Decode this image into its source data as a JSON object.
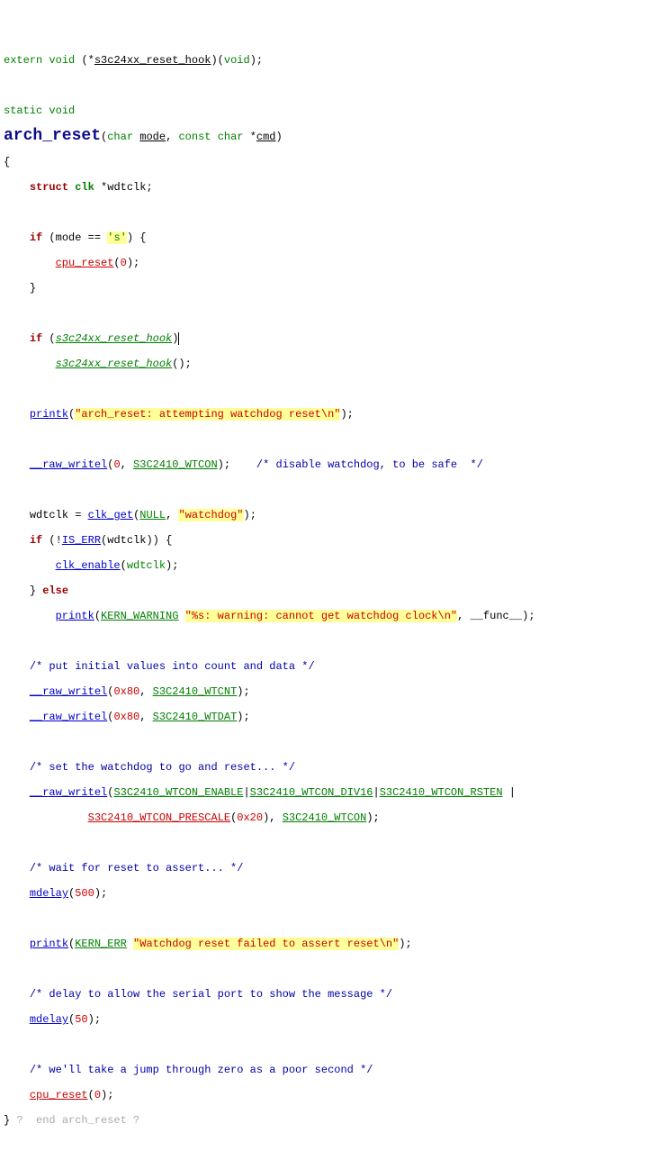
{
  "l1": {
    "extern": "extern",
    "void": "void",
    "star": "*",
    "fn": "s3c24xx_reset_hook",
    "paren": ")(",
    "void2": "void",
    "end": ");"
  },
  "l3": {
    "static": "static",
    "void": "void"
  },
  "l4": {
    "fn": "arch_reset",
    "open": "(",
    "char1": "char",
    "mode": "mode",
    "comma": ", ",
    "const": "const",
    "char2": "char",
    "star": "*",
    "cmd": "cmd",
    "close": ")"
  },
  "l5": {
    "brace": "{"
  },
  "l6": {
    "struct": "struct",
    "clk": "clk",
    "star": "*",
    "var": "wdtclk;"
  },
  "l8": {
    "if": "if",
    "open": " (",
    "mode": "mode",
    "eq": " == ",
    "lit": "'s'",
    "close": ") {"
  },
  "l9": {
    "fn": "cpu_reset",
    "args": "(",
    "zero": "0",
    "end": ");"
  },
  "l10": {
    "brace": "}"
  },
  "l12": {
    "if": "if",
    "open": " (",
    "fn": "s3c24xx_reset_hook",
    "close": ")"
  },
  "l13": {
    "fn": "s3c24xx_reset_hook",
    "args": "();"
  },
  "l15": {
    "fn": "printk",
    "open": "(",
    "str": "\"arch_reset: attempting watchdog reset\\n\"",
    "close": ");"
  },
  "l17": {
    "fn": "__raw_writel",
    "open": "(",
    "zero": "0",
    "comma": ", ",
    "macro": "S3C2410_WTCON",
    "close": ");",
    "comment": "/* disable watchdog, to be safe  */"
  },
  "l19": {
    "var": "wdtclk",
    "eq": " = ",
    "fn": "clk_get",
    "open": "(",
    "null": "NULL",
    "comma": ", ",
    "str": "\"watchdog\"",
    "close": ");"
  },
  "l20": {
    "if": "if",
    "open": " (!",
    "iserr": "IS_ERR",
    "p1": "(",
    "var": "wdtclk",
    "p2": ")) {"
  },
  "l21": {
    "fn": "clk_enable",
    "open": "(",
    "var": "wdtclk",
    "close": ");"
  },
  "l22": {
    "brace": "} ",
    "else": "else"
  },
  "l23": {
    "fn": "printk",
    "open": "(",
    "kw": "KERN_WARNING",
    "sp": " ",
    "str": "\"%s: warning: cannot get watchdog clock\\n\"",
    "comma": ", ",
    "func": "__func__",
    "close": ");"
  },
  "l25": {
    "comment": "/* put initial values into count and data */"
  },
  "l26": {
    "fn": "__raw_writel",
    "open": "(",
    "hex": "0x80",
    "comma": ", ",
    "macro": "S3C2410_WTCNT",
    "close": ");"
  },
  "l27": {
    "fn": "__raw_writel",
    "open": "(",
    "hex": "0x80",
    "comma": ", ",
    "macro": "S3C2410_WTDAT",
    "close": ");"
  },
  "l29": {
    "comment": "/* set the watchdog to go and reset... */"
  },
  "l30": {
    "fn": "__raw_writel",
    "open": "(",
    "m1": "S3C2410_WTCON_ENABLE",
    "pipe1": "|",
    "m2": "S3C2410_WTCON_DIV16",
    "pipe2": "|",
    "m3": "S3C2410_WTCON_RSTEN",
    "sp": " |"
  },
  "l31": {
    "m4": "S3C2410_WTCON_PRESCALE",
    "open": "(",
    "hex": "0x20",
    "close": "), ",
    "macro": "S3C2410_WTCON",
    "end": ");"
  },
  "l33": {
    "comment": "/* wait for reset to assert... */"
  },
  "l34": {
    "fn": "mdelay",
    "open": "(",
    "num": "500",
    "close": ");"
  },
  "l36": {
    "fn": "printk",
    "open": "(",
    "kw": "KERN_ERR",
    "sp": " ",
    "str": "\"Watchdog reset failed to assert reset\\n\"",
    "close": ");"
  },
  "l38": {
    "comment": "/* delay to allow the serial port to show the message */"
  },
  "l39": {
    "fn": "mdelay",
    "open": "(",
    "num": "50",
    "close": ");"
  },
  "l41": {
    "comment": "/* we'll take a jump through zero as a poor second */"
  },
  "l42": {
    "fn": "cpu_reset",
    "open": "(",
    "zero": "0",
    "close": ");"
  },
  "l43": {
    "brace": "}",
    "tail": " ?  end arch_reset ?"
  }
}
